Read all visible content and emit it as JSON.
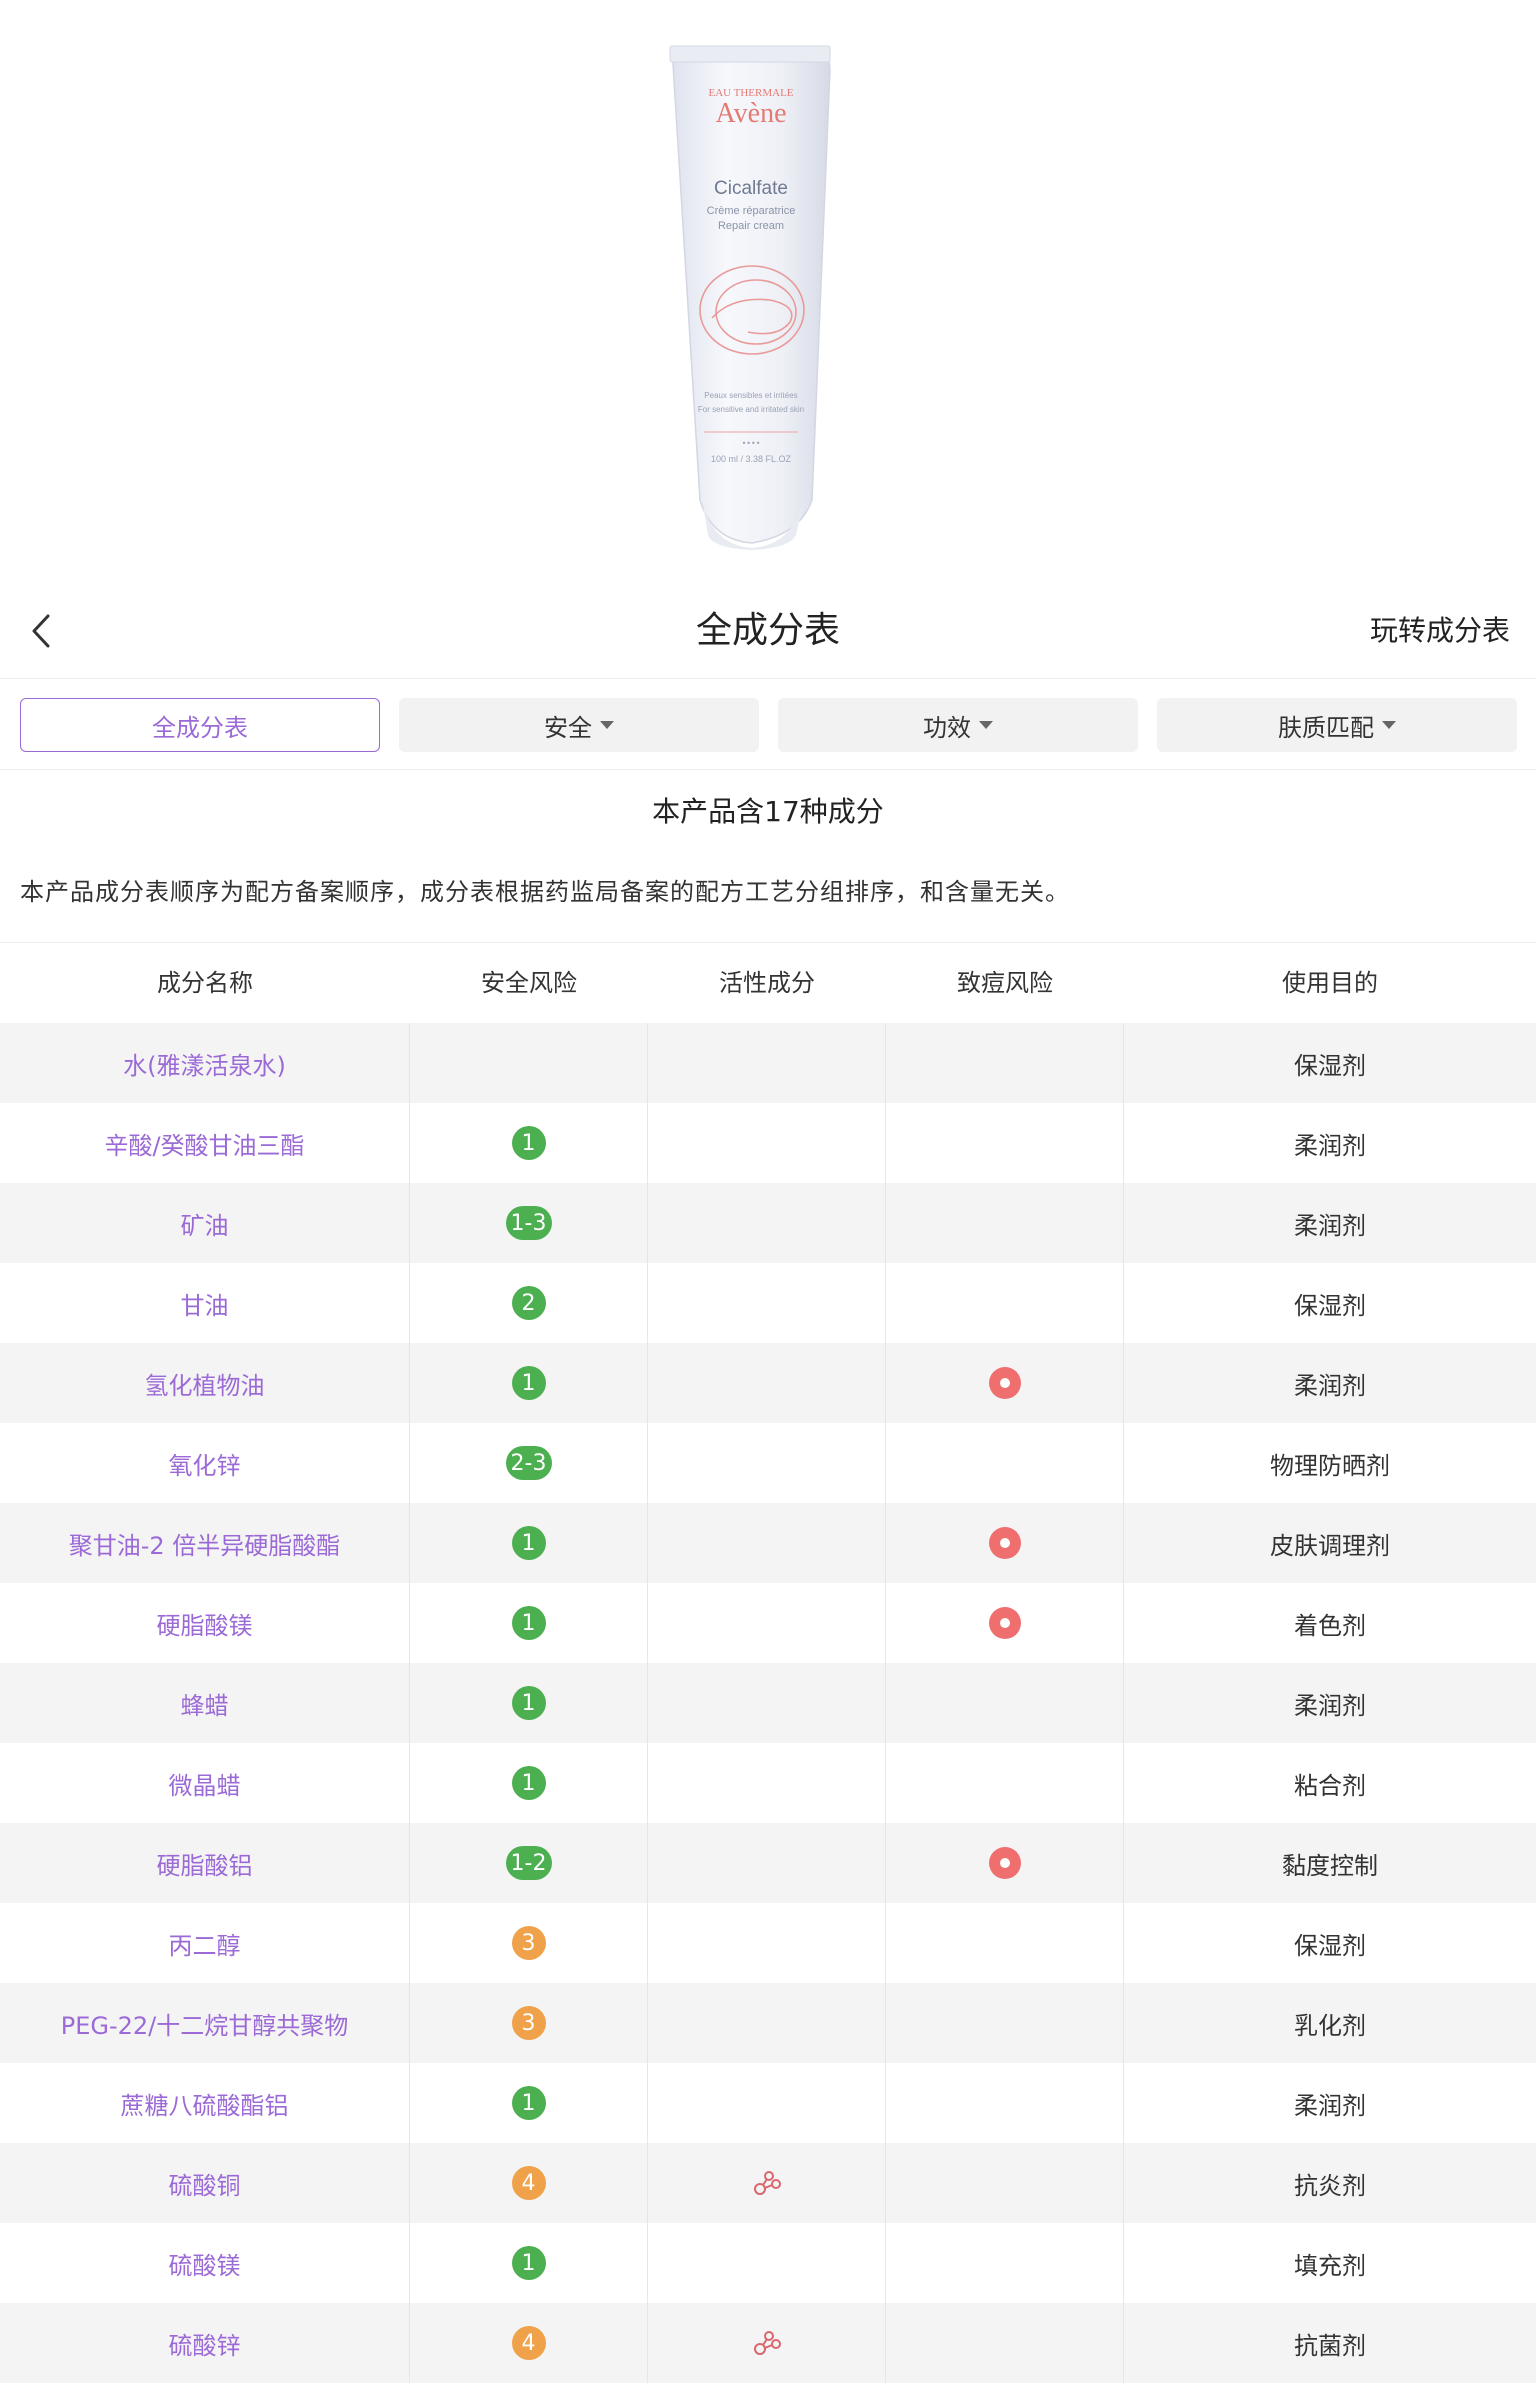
{
  "colors": {
    "accent": "#9b6ad6",
    "safe": "#4caf50",
    "medium": "#f0a24a",
    "acne": "#ef6f6f"
  },
  "product": {
    "brand_top": "EAU THERMALE",
    "brand": "Avène",
    "name": "Cicalfate",
    "subtitle1": "Crème réparatrice",
    "subtitle2": "Repair cream",
    "fine1": "Peaux sensibles et irritées",
    "fine2": "For sensitive and irritated skin",
    "volume": "100 ml / 3.38 FL.OZ"
  },
  "nav": {
    "title": "全成分表",
    "right_label": "玩转成分表",
    "back_icon": "chevron-left-icon"
  },
  "tabs": [
    {
      "label": "全成分表",
      "active": true
    },
    {
      "label": "安全",
      "dropdown": true
    },
    {
      "label": "功效",
      "dropdown": true
    },
    {
      "label": "肤质匹配",
      "dropdown": true
    }
  ],
  "summary": "本产品含17种成分",
  "note": "本产品成分表顺序为配方备案顺序，成分表根据药监局备案的配方工艺分组排序，和含量无关。",
  "table": {
    "headers": [
      "成分名称",
      "安全风险",
      "活性成分",
      "致痘风险",
      "使用目的"
    ],
    "rows": [
      {
        "name": "水(雅漾活泉水)",
        "risk": "",
        "active": false,
        "acne": false,
        "purpose": "保湿剂"
      },
      {
        "name": "辛酸/癸酸甘油三酯",
        "risk": "1",
        "active": false,
        "acne": false,
        "purpose": "柔润剂"
      },
      {
        "name": "矿油",
        "risk": "1-3",
        "active": false,
        "acne": false,
        "purpose": "柔润剂"
      },
      {
        "name": "甘油",
        "risk": "2",
        "active": false,
        "acne": false,
        "purpose": "保湿剂"
      },
      {
        "name": "氢化植物油",
        "risk": "1",
        "active": false,
        "acne": true,
        "purpose": "柔润剂"
      },
      {
        "name": "氧化锌",
        "risk": "2-3",
        "active": false,
        "acne": false,
        "purpose": "物理防晒剂"
      },
      {
        "name": "聚甘油-2 倍半异硬脂酸酯",
        "risk": "1",
        "active": false,
        "acne": true,
        "purpose": "皮肤调理剂"
      },
      {
        "name": "硬脂酸镁",
        "risk": "1",
        "active": false,
        "acne": true,
        "purpose": "着色剂"
      },
      {
        "name": "蜂蜡",
        "risk": "1",
        "active": false,
        "acne": false,
        "purpose": "柔润剂"
      },
      {
        "name": "微晶蜡",
        "risk": "1",
        "active": false,
        "acne": false,
        "purpose": "粘合剂"
      },
      {
        "name": "硬脂酸铝",
        "risk": "1-2",
        "active": false,
        "acne": true,
        "purpose": "黏度控制"
      },
      {
        "name": "丙二醇",
        "risk": "3",
        "active": false,
        "acne": false,
        "purpose": "保湿剂"
      },
      {
        "name": "PEG-22/十二烷甘醇共聚物",
        "risk": "3",
        "active": false,
        "acne": false,
        "purpose": "乳化剂"
      },
      {
        "name": "蔗糖八硫酸酯铝",
        "risk": "1",
        "active": false,
        "acne": false,
        "purpose": "柔润剂"
      },
      {
        "name": "硫酸铜",
        "risk": "4",
        "active": true,
        "acne": false,
        "purpose": "抗炎剂"
      },
      {
        "name": "硫酸镁",
        "risk": "1",
        "active": false,
        "acne": false,
        "purpose": "填充剂"
      },
      {
        "name": "硫酸锌",
        "risk": "4",
        "active": true,
        "acne": false,
        "purpose": "抗菌剂"
      }
    ]
  }
}
